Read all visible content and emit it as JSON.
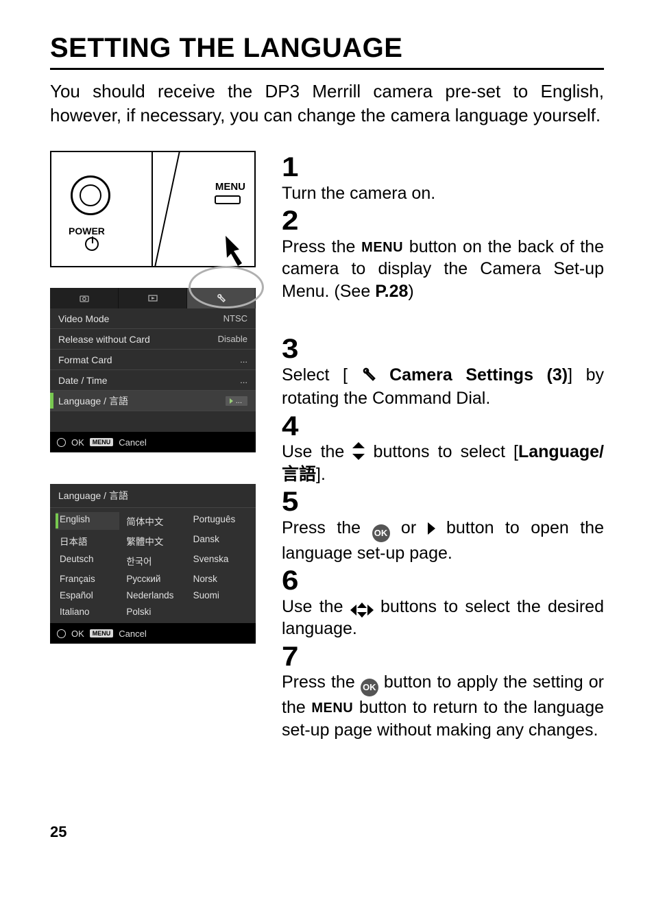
{
  "title": "SETTING THE LANGUAGE",
  "intro": "You should receive the DP3 Merrill camera pre-set to English, however, if necessary, you can change the camera language yourself.",
  "camdiag": {
    "power": "POWER",
    "menu": "MENU"
  },
  "menu": {
    "rows": [
      {
        "label": "Video Mode",
        "value": "NTSC"
      },
      {
        "label": "Release without Card",
        "value": "Disable"
      },
      {
        "label": "Format Card",
        "value": "..."
      },
      {
        "label": "Date / Time",
        "value": "..."
      },
      {
        "label": "Language / 言語",
        "value": "..."
      }
    ],
    "foot_ok": "OK",
    "foot_menu_tag": "MENU",
    "foot_cancel": "Cancel"
  },
  "langmenu": {
    "title": "Language / 言語",
    "items": [
      "English",
      "简体中文",
      "Português",
      "日本語",
      "繁體中文",
      "Dansk",
      "Deutsch",
      "한국어",
      "Svenska",
      "Français",
      "Русский",
      "Norsk",
      "Español",
      "Nederlands",
      "Suomi",
      "Italiano",
      "Polski",
      ""
    ],
    "foot_ok": "OK",
    "foot_menu_tag": "MENU",
    "foot_cancel": "Cancel"
  },
  "steps": {
    "s1": {
      "num": "1",
      "text": "Turn the camera on."
    },
    "s2": {
      "num": "2",
      "before": "Press the ",
      "menu": "MENU",
      "after": " button on the back of the camera to display the Camera Set-up Menu. (See ",
      "pref": "P.28",
      "tail": ")"
    },
    "s3": {
      "num": "3",
      "before": "Select  [ ",
      "bold": " Camera  Settings  (3)",
      "after": "]  by rotating the Command Dial."
    },
    "s4": {
      "num": "4",
      "before": "Use the ",
      "mid": " buttons to select [",
      "bold": "Language/ 言語",
      "after": "]."
    },
    "s5": {
      "num": "5",
      "before": "Press the ",
      "ok": "OK",
      "mid": " or ",
      "after": " button to open the language set-up page."
    },
    "s6": {
      "num": "6",
      "before": "Use the ",
      "after": " buttons to select the desired language."
    },
    "s7": {
      "num": "7",
      "before": "Press the ",
      "ok": "OK",
      "mid": "  button to apply the setting or the ",
      "menu": "MENU",
      "after": " button to return to the language set-up page without making any changes."
    }
  },
  "pagenum": "25"
}
